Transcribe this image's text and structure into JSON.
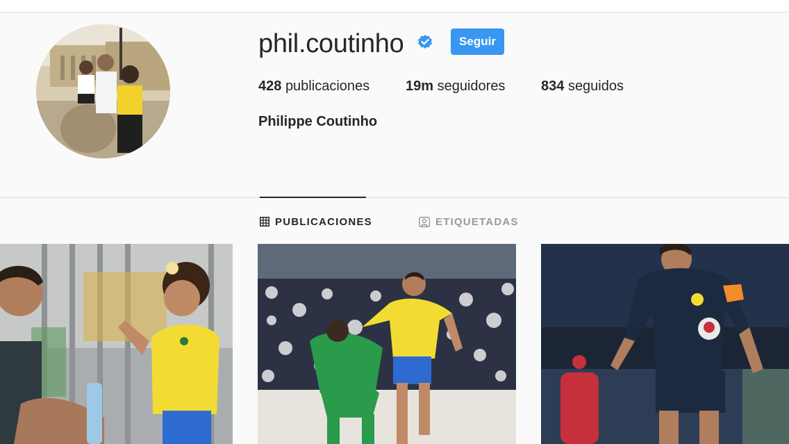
{
  "profile": {
    "username": "phil.coutinho",
    "verified": true,
    "follow_label": "Seguir",
    "full_name": "Philippe Coutinho",
    "avatar_icon": "profile-photo"
  },
  "stats": {
    "posts_count": "428",
    "posts_label": "publicaciones",
    "followers_count": "19m",
    "followers_label": "seguidores",
    "following_count": "834",
    "following_label": "seguidos"
  },
  "tabs": [
    {
      "label": "PUBLICACIONES",
      "icon": "grid-icon",
      "active": true
    },
    {
      "label": "ETIQUETADAS",
      "icon": "tagged-icon",
      "active": false
    }
  ],
  "posts": [
    {
      "icon": "post-photo"
    },
    {
      "icon": "post-photo"
    },
    {
      "icon": "post-photo"
    }
  ],
  "colors": {
    "accent": "#3897f0",
    "background": "#fafafa",
    "text": "#262626",
    "muted": "#999999",
    "border": "#dbdbdb"
  }
}
